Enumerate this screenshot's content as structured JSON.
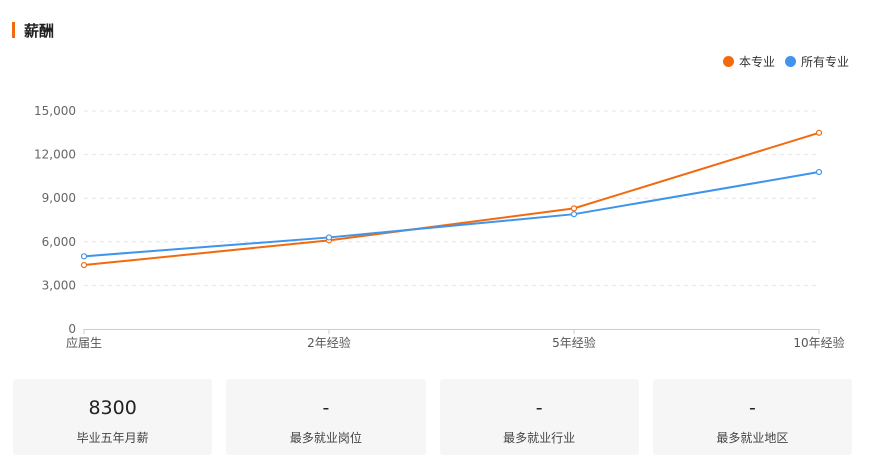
{
  "section": {
    "title": "薪酬"
  },
  "chart_data": {
    "type": "line",
    "categories": [
      "应届生",
      "2年经验",
      "5年经验",
      "10年经验"
    ],
    "series": [
      {
        "name": "本专业",
        "color": "#f26a10",
        "values": [
          4400,
          6100,
          8300,
          13500
        ]
      },
      {
        "name": "所有专业",
        "color": "#3f94ec",
        "values": [
          5000,
          6300,
          7900,
          10800
        ]
      }
    ],
    "y_ticks": [
      "0",
      "3,000",
      "6,000",
      "9,000",
      "12,000",
      "15,000"
    ],
    "ylim": [
      0,
      15000
    ],
    "legend": "top-right",
    "grid": true
  },
  "cards": [
    {
      "value": "8300",
      "label": "毕业五年月薪"
    },
    {
      "value": "-",
      "label": "最多就业岗位"
    },
    {
      "value": "-",
      "label": "最多就业行业"
    },
    {
      "value": "-",
      "label": "最多就业地区"
    }
  ]
}
